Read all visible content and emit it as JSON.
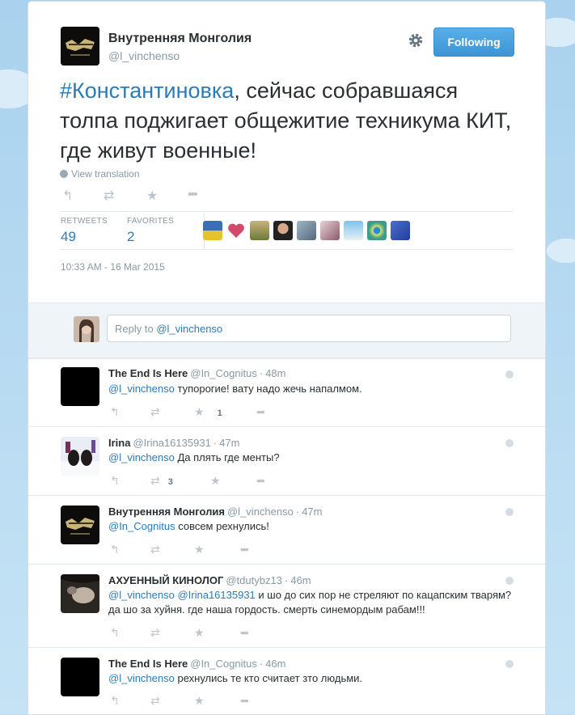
{
  "tweet": {
    "author_name": "Внутренняя Монголия",
    "author_handle": "@l_vinchenso",
    "follow_label": "Following",
    "hashtag": "#Константиновка",
    "text": ", сейчас собравшаяся толпа поджигает общежитие техникума КИТ, где живут военные!",
    "view_translation": "View translation",
    "retweets_label": "RETWEETS",
    "retweets_count": "49",
    "favorites_label": "FAVORITES",
    "favorites_count": "2",
    "timestamp": "10:33 AM - 16 Mar 2015",
    "icons": [
      "reply-icon",
      "retweet-icon",
      "favorite-icon",
      "more-icon",
      "gear-icon",
      "globe-icon"
    ]
  },
  "reply_box": {
    "prefix": "Reply to ",
    "mention": "@l_vinchenso"
  },
  "replies": [
    {
      "name": "The End Is Here",
      "handle": "@In_Cognitus",
      "time": "48m",
      "mention": "@l_vinchenso",
      "text": " тупорогие! вату надо жечь напалмом.",
      "retweets": "",
      "favorites": "1"
    },
    {
      "name": "Irina",
      "handle": "@Irina16135931",
      "time": "47m",
      "mention": "@l_vinchenso",
      "text": " Да плять где менты?",
      "retweets": "3",
      "favorites": ""
    },
    {
      "name": "Внутренняя Монголия",
      "handle": "@l_vinchenso",
      "time": "47m",
      "mention": "@In_Cognitus",
      "text": " совсем рехнулись!",
      "retweets": "",
      "favorites": ""
    },
    {
      "name": "АХУЕННЫЙ КИНОЛОГ",
      "handle": "@tdutybz13",
      "time": "46m",
      "mention": "@l_vinchenso @Irina16135931",
      "text": " и шо до сих пор не стреляют по кацапским тварям?да шо за хуйня. где наша гордость. смерть синемордым рабам!!!",
      "retweets": "",
      "favorites": ""
    },
    {
      "name": "The End Is Here",
      "handle": "@In_Cognitus",
      "time": "46m",
      "mention": "@l_vinchenso",
      "text": " рехнулись те кто считает зто людьми.",
      "retweets": "",
      "favorites": ""
    }
  ],
  "colors": {
    "link": "#2b7bb9",
    "follow_button": "#4aa3df",
    "muted": "#8899a6"
  }
}
